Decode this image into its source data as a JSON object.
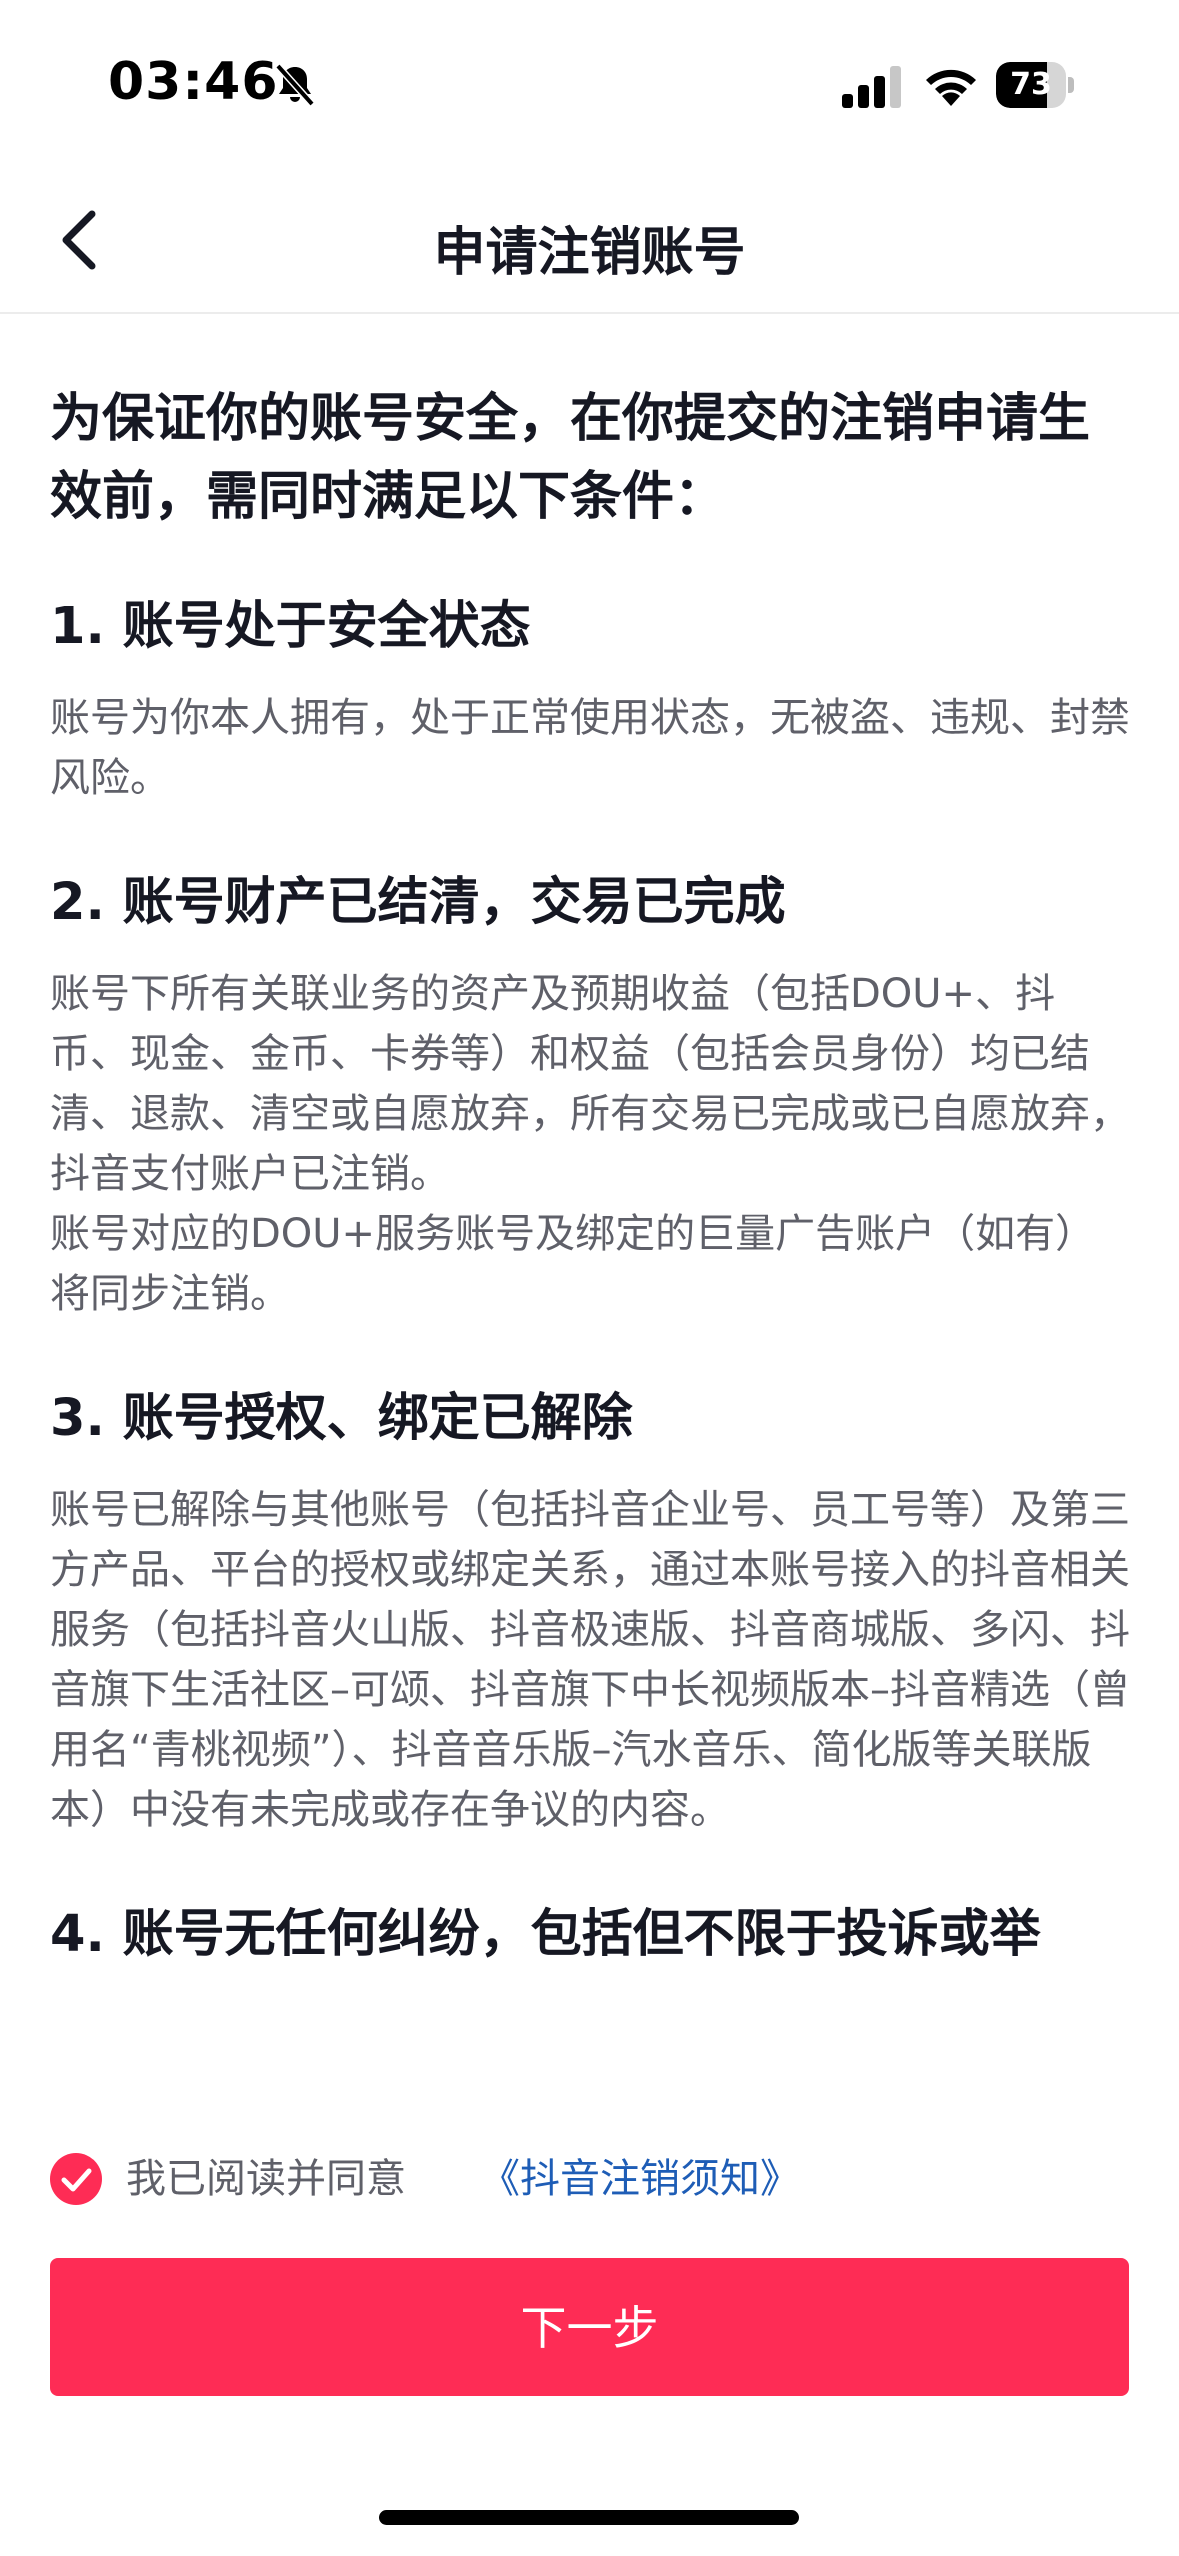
{
  "status": {
    "time": "03:46",
    "battery": "73",
    "battery_level": 0.73
  },
  "header": {
    "title": "申请注销账号"
  },
  "intro": "为保证你的账号安全，在你提交的注销申请生效前，需同时满足以下条件：",
  "sections": [
    {
      "title": "1. 账号处于安全状态",
      "body": "账号为你本人拥有，处于正常使用状态，无被盗、违规、封禁风险。"
    },
    {
      "title": "2. 账号财产已结清，交易已完成",
      "body": "账号下所有关联业务的资产及预期收益（包括DOU+、抖币、现金、金币、卡券等）和权益（包括会员身份）均已结清、退款、清空或自愿放弃，所有交易已完成或已自愿放弃，抖音支付账户已注销。\n账号对应的DOU+服务账号及绑定的巨量广告账户（如有）将同步注销。"
    },
    {
      "title": "3. 账号授权、绑定已解除",
      "body": "账号已解除与其他账号（包括抖音企业号、员工号等）及第三方产品、平台的授权或绑定关系，通过本账号接入的抖音相关服务（包括抖音火山版、抖音极速版、抖音商城版、多闪、抖音旗下生活社区–可颂、抖音旗下中长视频版本–抖音精选（曾用名“青桃视频”）、抖音音乐版–汽水音乐、简化版等关联版本）中没有未完成或存在争议的内容。"
    },
    {
      "title": "4. 账号无任何纠纷，包括但不限于投诉或举",
      "body": ""
    }
  ],
  "agreement": {
    "prefix": "我已阅读并同意",
    "link": "《抖音注销须知》",
    "checked": true
  },
  "next_button": "下一步",
  "colors": {
    "accent": "#fe2c55",
    "link": "#1e5db6"
  }
}
